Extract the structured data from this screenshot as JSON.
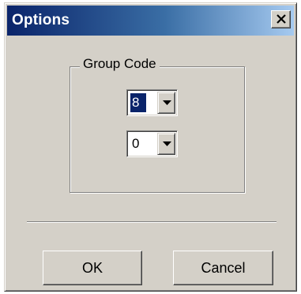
{
  "window": {
    "title": "Options",
    "close_glyph": "×",
    "accent_color": "#0a246a"
  },
  "group": {
    "label": "Group Code",
    "combos": [
      {
        "value": "8",
        "selected": true
      },
      {
        "value": "0",
        "selected": false
      }
    ]
  },
  "buttons": {
    "ok_label": "OK",
    "cancel_label": "Cancel"
  },
  "icons": {
    "close": "close-icon",
    "dropdown": "chevron-down-icon"
  }
}
